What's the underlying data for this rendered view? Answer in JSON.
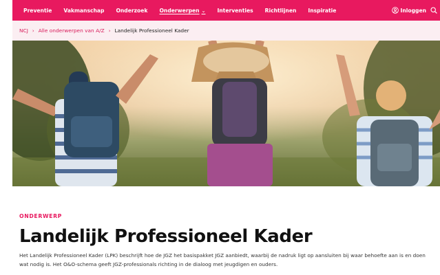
{
  "nav": {
    "items": [
      {
        "label": "Preventie"
      },
      {
        "label": "Vakmanschap"
      },
      {
        "label": "Onderzoek"
      },
      {
        "label": "Onderwerpen",
        "active": true
      },
      {
        "label": "Interventies"
      },
      {
        "label": "Richtlijnen"
      },
      {
        "label": "Inspiratie"
      }
    ],
    "login_label": "Inloggen",
    "icons": {
      "login": "user-icon",
      "search": "search-icon",
      "dropdown": "chevron-down-icon"
    }
  },
  "breadcrumb": {
    "items": [
      "NCJ",
      "Alle onderwerpen van A/Z"
    ],
    "current": "Landelijk Professioneel Kader"
  },
  "page": {
    "eyebrow": "ONDERWERP",
    "title": "Landelijk Professioneel Kader",
    "description": "Het Landelijk Professioneel Kader (LPK) beschrijft hoe de JGZ het basispakket JGZ aanbiedt, waarbij de nadruk ligt op aansluiten bij waar behoefte aan is en doen wat nodig is. Het O&O-schema geeft JGZ-professionals richting in de dialoog met jeugdigen en ouders."
  },
  "colors": {
    "brand": "#e8195f",
    "breadcrumb_bg": "#fbeef2"
  }
}
